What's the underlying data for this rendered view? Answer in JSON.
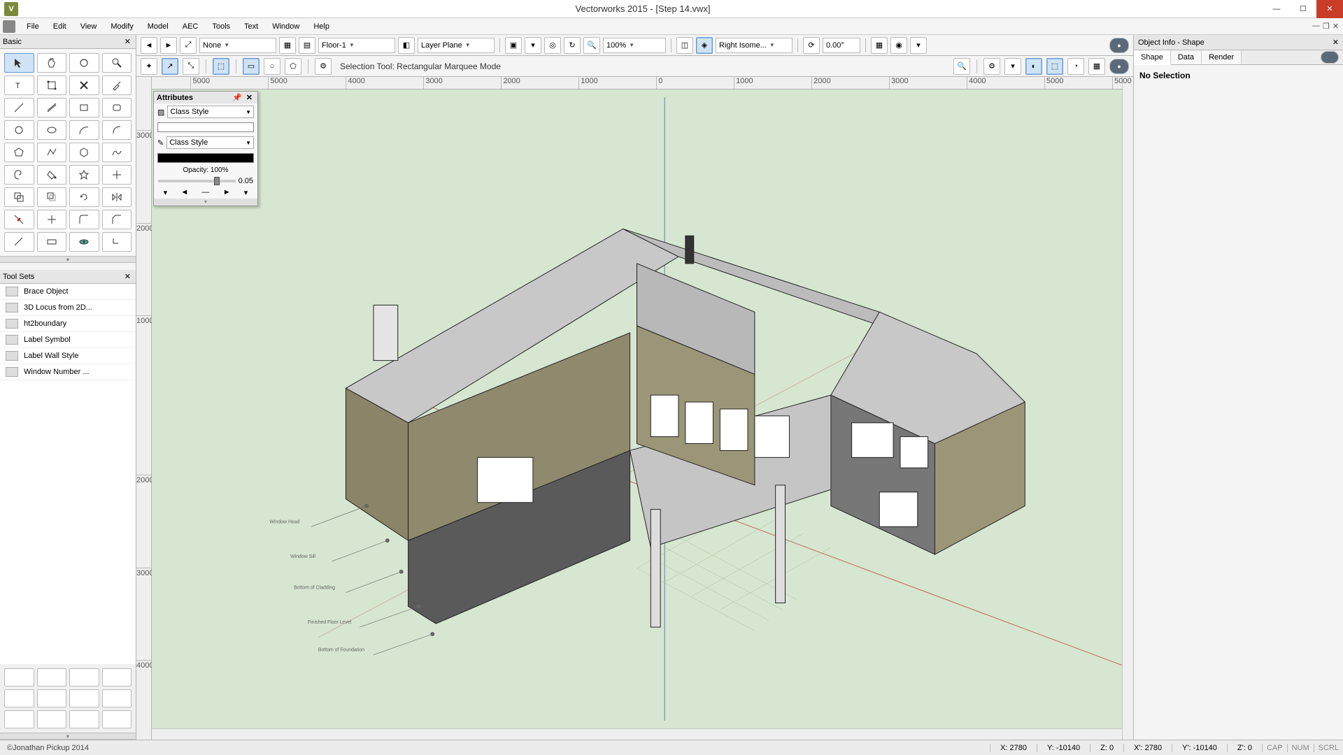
{
  "app": {
    "icon_letter": "V",
    "title": "Vectorworks 2015 - [Step 14.vwx]"
  },
  "menu": [
    "File",
    "Edit",
    "View",
    "Modify",
    "Model",
    "AEC",
    "Tools",
    "Text",
    "Window",
    "Help"
  ],
  "viewbar": {
    "class_combo": "None",
    "layer_combo": "Floor-1",
    "plane_combo": "Layer Plane",
    "zoom_value": "100%",
    "view_combo": "Right Isome...",
    "rotation": "0.00°"
  },
  "modebar": {
    "status": "Selection Tool: Rectangular Marquee Mode"
  },
  "basic_palette": {
    "title": "Basic"
  },
  "toolsets": {
    "title": "Tool Sets",
    "items": [
      "Brace Object",
      "3D Locus from 2D...",
      "ht2boundary",
      "Label Symbol",
      "Label Wall Style",
      "Window Number ..."
    ]
  },
  "attributes": {
    "title": "Attributes",
    "fill_mode": "Class Style",
    "pen_mode": "Class Style",
    "opacity_label": "Opacity: 100%",
    "line_value": "0.05"
  },
  "ruler_h": [
    "5000",
    "5000",
    "4000",
    "3000",
    "2000",
    "1000",
    "0",
    "1000",
    "2000",
    "3000",
    "4000",
    "5000",
    "5000"
  ],
  "ruler_v": [
    "3000",
    "2000",
    "1000",
    "2000",
    "3000",
    "4000"
  ],
  "object_info": {
    "title": "Object Info - Shape",
    "tabs": [
      "Shape",
      "Data",
      "Render"
    ],
    "body": "No Selection"
  },
  "annotations": [
    "Window Head",
    "Window Sill",
    "Bottom of Cladding",
    "Finished Floor Level",
    "Bottom of Foundation"
  ],
  "status": {
    "copyright": "©Jonathan Pickup 2014",
    "coords": {
      "x": "X: 2780",
      "y": "Y: -10140",
      "z": "Z: 0",
      "x2": "X': 2780",
      "y2": "Y': -10140",
      "z2": "Z': 0"
    },
    "indicators": [
      "CAP",
      "NUM",
      "SCRL"
    ]
  }
}
